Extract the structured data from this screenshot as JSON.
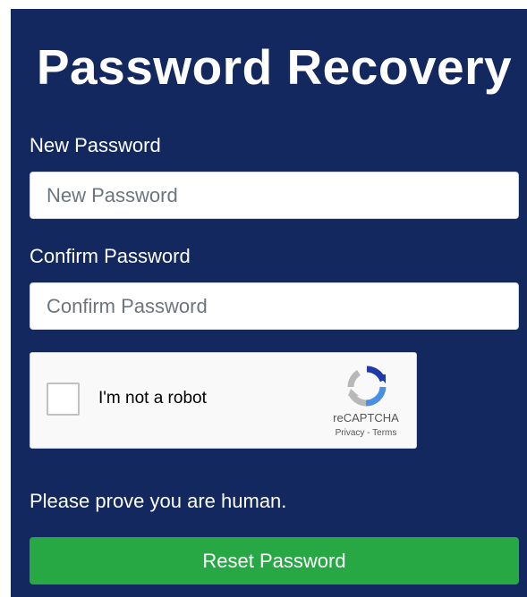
{
  "page": {
    "title": "Password Recovery"
  },
  "new_password": {
    "label": "New Password",
    "placeholder": "New Password",
    "value": ""
  },
  "confirm_password": {
    "label": "Confirm Password",
    "placeholder": "Confirm Password",
    "value": ""
  },
  "captcha": {
    "checkbox_label": "I'm not a robot",
    "brand": "reCAPTCHA",
    "privacy_link": "Privacy",
    "separator": " - ",
    "terms_link": "Terms",
    "checked": false,
    "icon": "recaptcha-logo-icon"
  },
  "hint": "Please prove you are human.",
  "reset_button": {
    "label": "Reset Password"
  },
  "colors": {
    "panel_background": "#13285f",
    "button_background": "#28a745",
    "text_on_dark": "#ffffff"
  }
}
